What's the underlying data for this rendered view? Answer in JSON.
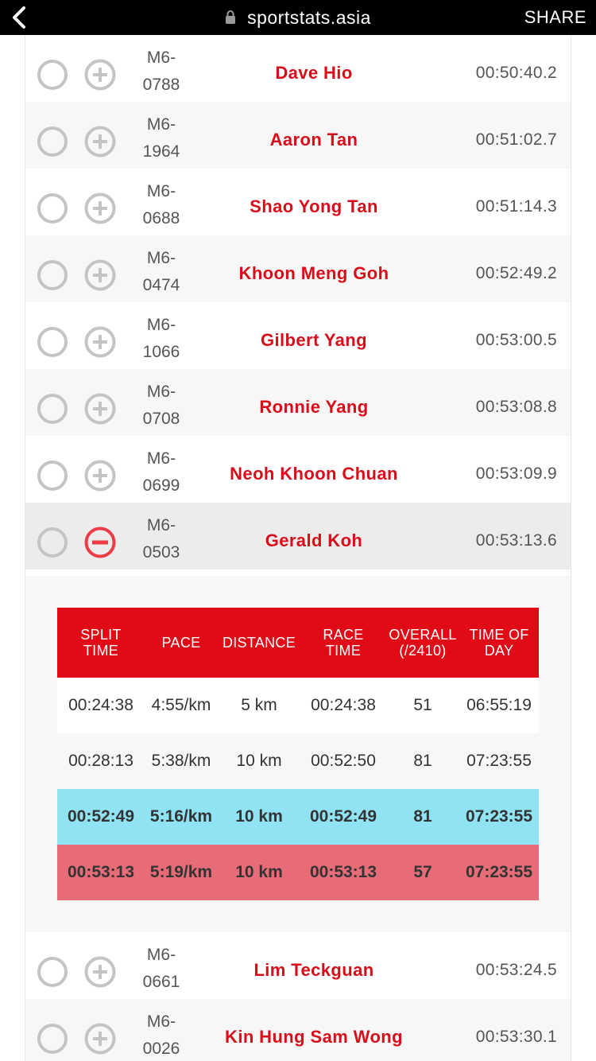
{
  "browser": {
    "url": "sportstats.asia",
    "share_label": "SHARE"
  },
  "rows_top": [
    {
      "bib_line1": "M6-",
      "bib_line2": "0788",
      "name": "Dave Hio",
      "time": "00:50:40.2"
    },
    {
      "bib_line1": "M6-",
      "bib_line2": "1964",
      "name": "Aaron Tan",
      "time": "00:51:02.7"
    },
    {
      "bib_line1": "M6-",
      "bib_line2": "0688",
      "name": "Shao Yong Tan",
      "time": "00:51:14.3"
    },
    {
      "bib_line1": "M6-",
      "bib_line2": "0474",
      "name": "Khoon Meng Goh",
      "time": "00:52:49.2"
    },
    {
      "bib_line1": "M6-",
      "bib_line2": "1066",
      "name": "Gilbert Yang",
      "time": "00:53:00.5"
    },
    {
      "bib_line1": "M6-",
      "bib_line2": "0708",
      "name": "Ronnie Yang",
      "time": "00:53:08.8"
    },
    {
      "bib_line1": "M6-",
      "bib_line2": "0699",
      "name": "Neoh Khoon Chuan",
      "time": "00:53:09.9"
    },
    {
      "bib_line1": "M6-",
      "bib_line2": "0503",
      "name": "Gerald Koh",
      "time": "00:53:13.6"
    }
  ],
  "splits": {
    "headers": [
      {
        "l1": "SPLIT",
        "l2": "TIME"
      },
      {
        "l1": "PACE",
        "l2": ""
      },
      {
        "l1": "DISTANCE",
        "l2": ""
      },
      {
        "l1": "RACE",
        "l2": "TIME"
      },
      {
        "l1": "OVERALL",
        "l2": "(/2410)"
      },
      {
        "l1": "TIME OF",
        "l2": "DAY"
      }
    ],
    "rows": [
      {
        "split_time": "00:24:38",
        "pace": "4:55/km",
        "distance": "5 km",
        "race_time": "00:24:38",
        "overall": "51",
        "time_of_day": "06:55:19"
      },
      {
        "split_time": "00:28:13",
        "pace": "5:38/km",
        "distance": "10 km",
        "race_time": "00:52:50",
        "overall": "81",
        "time_of_day": "07:23:55"
      },
      {
        "split_time": "00:52:49",
        "pace": "5:16/km",
        "distance": "10 km",
        "race_time": "00:52:49",
        "overall": "81",
        "time_of_day": "07:23:55"
      },
      {
        "split_time": "00:53:13",
        "pace": "5:19/km",
        "distance": "10 km",
        "race_time": "00:53:13",
        "overall": "57",
        "time_of_day": "07:23:55"
      }
    ]
  },
  "rows_bottom": [
    {
      "bib_line1": "M6-",
      "bib_line2": "0661",
      "name": "Lim Teckguan",
      "time": "00:53:24.5"
    },
    {
      "bib_line1": "M6-",
      "bib_line2": "0026",
      "name": "Kin Hung Sam Wong",
      "time": "00:53:30.1"
    }
  ],
  "colors": {
    "brand_red": "#e00b16",
    "name_red": "#d90d1a",
    "highlight_blue": "#8fe3f3",
    "highlight_red": "#e86c78"
  }
}
